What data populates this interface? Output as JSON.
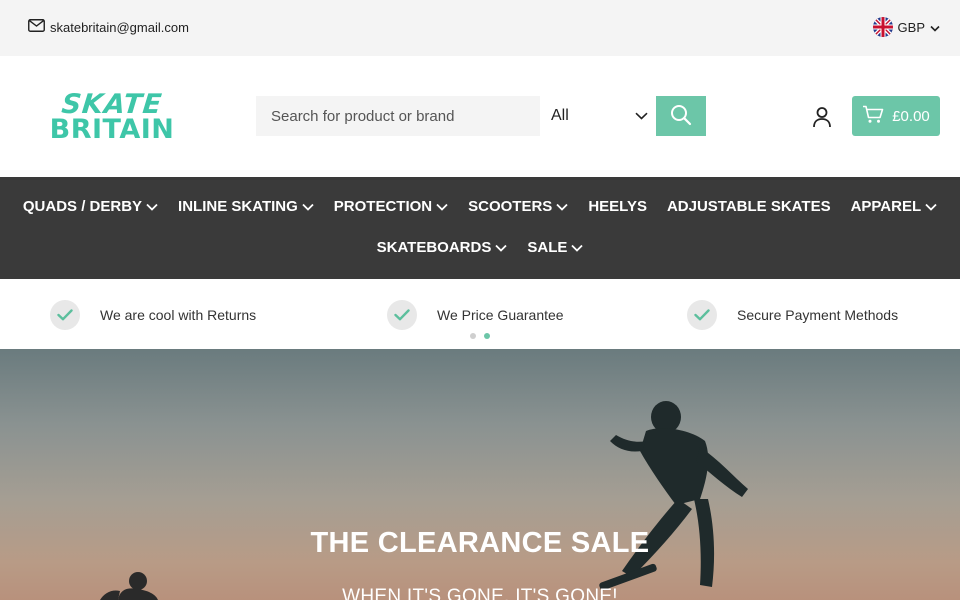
{
  "topbar": {
    "email": "skatebritain@gmail.com",
    "currency": "GBP"
  },
  "header": {
    "logo_line1": "SKATE",
    "logo_line2": "BRITAIN",
    "search_placeholder": "Search for product or brand",
    "category_selected": "All",
    "cart_total": "£0.00"
  },
  "nav": {
    "row1": [
      {
        "label": "QUADS / DERBY",
        "dropdown": true
      },
      {
        "label": "INLINE SKATING",
        "dropdown": true
      },
      {
        "label": "PROTECTION",
        "dropdown": true
      },
      {
        "label": "SCOOTERS",
        "dropdown": true
      },
      {
        "label": "HEELYS",
        "dropdown": false
      },
      {
        "label": "ADJUSTABLE SKATES",
        "dropdown": false
      },
      {
        "label": "APPAREL",
        "dropdown": true
      }
    ],
    "row2": [
      {
        "label": "SKATEBOARDS",
        "dropdown": true
      },
      {
        "label": "SALE",
        "dropdown": true
      }
    ]
  },
  "usp": [
    {
      "text": "We are cool with Returns"
    },
    {
      "text": "We Price Guarantee"
    },
    {
      "text": "Secure Payment Methods"
    }
  ],
  "hero": {
    "title": "THE CLEARANCE SALE",
    "subtitle": "WHEN IT'S GONE, IT'S GONE!"
  },
  "colors": {
    "accent": "#6cc6a8",
    "logo": "#3ec6a8",
    "nav_bg": "#3a3a3a",
    "topbar_bg": "#f4f4f4"
  },
  "icons": {
    "email": "mail-icon",
    "flag": "uk-flag-icon",
    "search": "search-icon",
    "account": "user-icon",
    "cart": "cart-icon",
    "usp": "check-icon"
  }
}
